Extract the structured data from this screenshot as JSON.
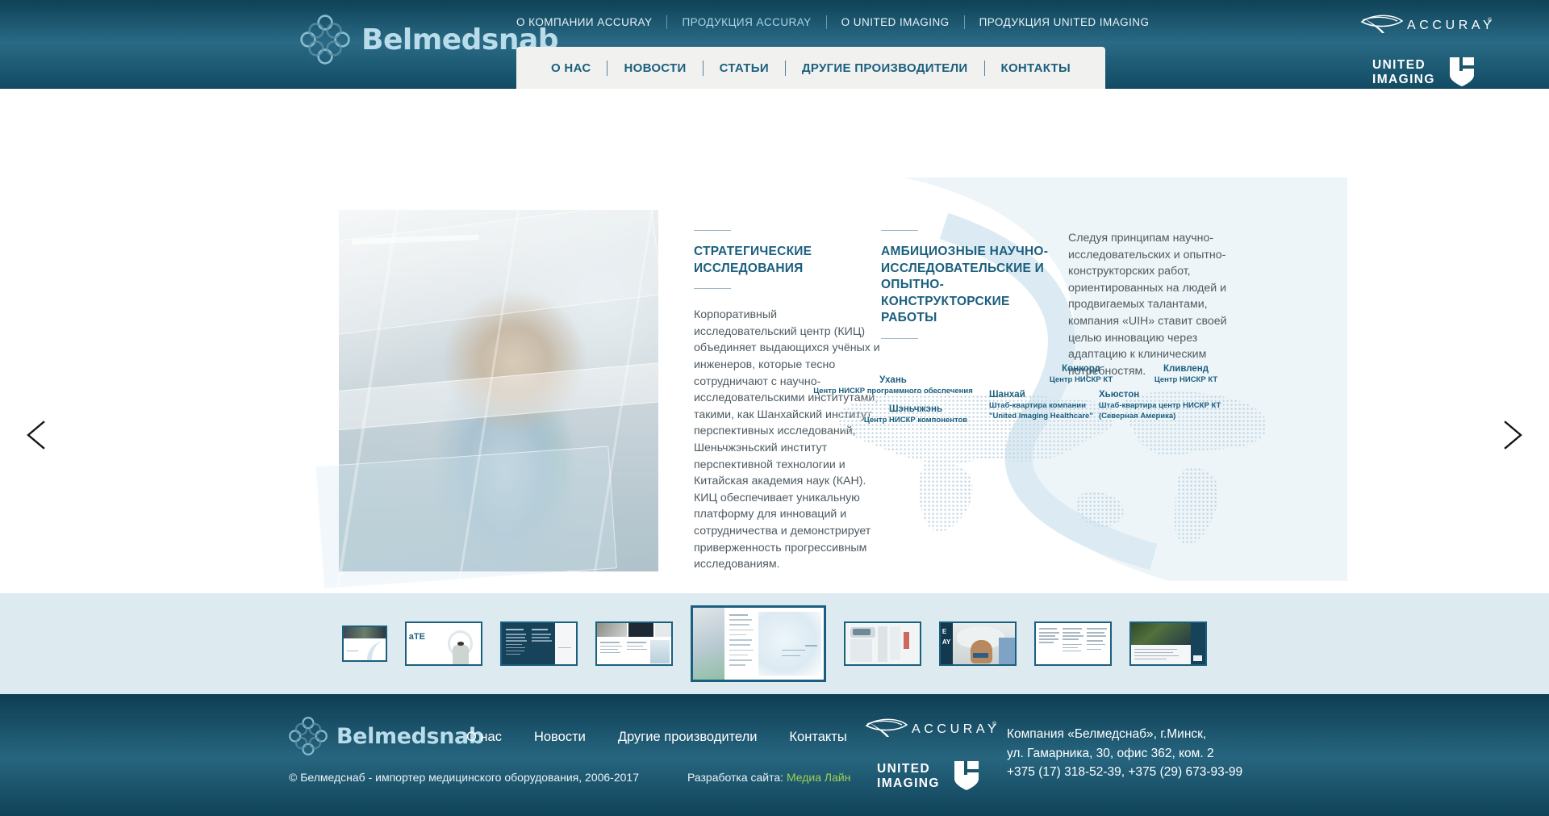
{
  "brand": {
    "name": "Belmedsnab",
    "logo_icon": "four-circle-cross-logo"
  },
  "header": {
    "topnav": [
      {
        "label": "О КОМПАНИИ ACCURAY",
        "active": false
      },
      {
        "label": "ПРОДУКЦИЯ ACCURAY",
        "active": true
      },
      {
        "label": "О UNITED IMAGING",
        "active": false
      },
      {
        "label": "ПРОДУКЦИЯ UNITED IMAGING",
        "active": false
      }
    ],
    "mainnav": [
      {
        "label": "О НАС"
      },
      {
        "label": "НОВОСТИ"
      },
      {
        "label": "СТАТЬИ"
      },
      {
        "label": "ДРУГИЕ ПРОИЗВОДИТЕЛИ"
      },
      {
        "label": "КОНТАКТЫ"
      }
    ],
    "partners": [
      {
        "name": "ACCURAY",
        "mark": "accuray-swoosh-icon",
        "trademark": "®"
      },
      {
        "name_line1": "UNITED",
        "name_line2": "IMAGING",
        "mark": "united-imaging-shield-icon"
      }
    ]
  },
  "slide": {
    "prev_arrow_icon": "chevron-left-icon",
    "next_arrow_icon": "chevron-right-icon",
    "hero_image_alt": "scientist-touchscreen-photo",
    "columns": [
      {
        "title": "СТРАТЕГИЧЕСКИЕ\nИССЛЕДОВАНИЯ",
        "body": "Корпоративный исследовательский центр (КИЦ) объединяет выдающихся учёных и инженеров, которые тесно сотрудничают с научно-исследовательскими институтами, такими, как Шанхайский институт перспективных исследований, Шеньчжэньский институт перспективной технологии и Китайская академия наук (КАН). КИЦ обеспечивает уникальную платформу для инноваций и сотрудничества и демонстрирует приверженность прогрессивным исследованиям."
      },
      {
        "title": "АМБИЦИОЗНЫЕ НАУЧНО-ИССЛЕДОВАТЕЛЬСКИЕ И ОПЫТНО-КОНСТРУКТОРСКИЕ РАБОТЫ",
        "body": ""
      },
      {
        "title": "",
        "body": "Следуя принципам научно-исследовательских и опытно-конструкторских работ, ориентированных на людей и продвигаемых талантами, компания «UIH» ставит своей целью инновацию через адаптацию к клиническим потребностям."
      }
    ],
    "map_labels": [
      {
        "city": "Ухань",
        "desc": "Центр НИСКР программного обеспечения"
      },
      {
        "city": "Шэньчжэнь",
        "desc": "Центр НИСКР компонентов"
      },
      {
        "city": "Конкорд",
        "desc": "Центр НИСКР КТ"
      },
      {
        "city": "Кливленд",
        "desc": "Центр НИСКР КТ"
      },
      {
        "city": "Шанхай",
        "desc": "Штаб-квартира компании\n\"United Imaging Healthcare\""
      },
      {
        "city": "Хьюстон",
        "desc": "Штаб-квартира центр НИСКР КТ\n(Северная Америка)"
      }
    ]
  },
  "thumbnails": {
    "count": 9,
    "active_index": 3,
    "items": [
      {
        "name": "slide-thumb-1",
        "size": "s"
      },
      {
        "name": "slide-thumb-2",
        "size": "m"
      },
      {
        "name": "slide-thumb-3",
        "size": "m"
      },
      {
        "name": "slide-thumb-4",
        "size": "m"
      },
      {
        "name": "slide-thumb-5-active",
        "size": "l"
      },
      {
        "name": "slide-thumb-6",
        "size": "m"
      },
      {
        "name": "slide-thumb-7",
        "size": "m"
      },
      {
        "name": "slide-thumb-8",
        "size": "m"
      },
      {
        "name": "slide-thumb-9",
        "size": "m"
      }
    ]
  },
  "footer": {
    "nav": [
      {
        "label": "О нас"
      },
      {
        "label": "Новости"
      },
      {
        "label": "Другие производители"
      },
      {
        "label": "Контакты"
      }
    ],
    "copyright": "© Белмедснаб - импортер медицинского оборудования, 2006-2017",
    "dev_prefix": "Разработка сайта:",
    "dev_link": "Медиа Лайн",
    "contact_lines": [
      "Компания «Белмедснаб», г.Минск,",
      "ул. Гамарника, 30, офис 362, ком. 2",
      "+375 (17) 318-52-39, +375 (29) 673-93-99"
    ],
    "partners": [
      {
        "name": "ACCURAY",
        "mark": "accuray-swoosh-icon",
        "trademark": "®"
      },
      {
        "name_line1": "UNITED",
        "name_line2": "IMAGING",
        "mark": "united-imaging-shield-icon"
      }
    ]
  },
  "colors": {
    "header_dark": "#0e4257",
    "header_mid": "#2a6a85",
    "accent_blue": "#1b5f7e",
    "brand_light": "#b9dcea",
    "band_bg": "#ddeaf0",
    "dev_link_green": "#9fd04f"
  }
}
